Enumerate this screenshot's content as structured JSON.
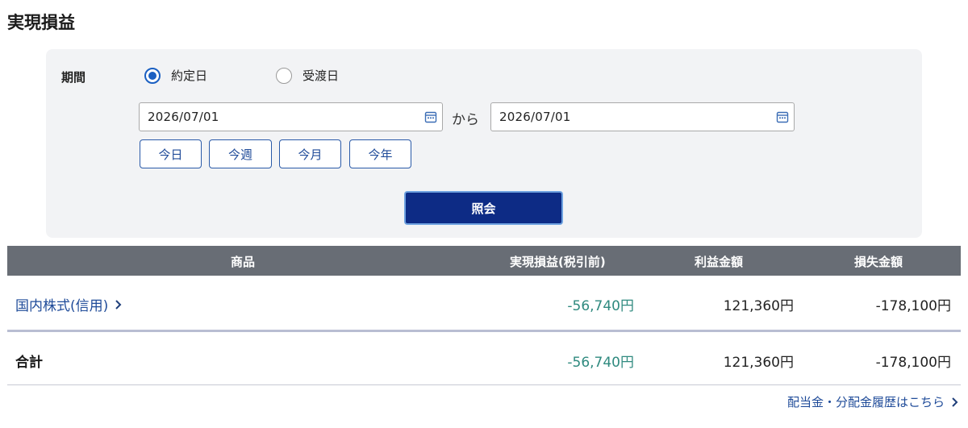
{
  "page": {
    "title": "実現損益"
  },
  "filter": {
    "period_label": "期間",
    "radios": [
      {
        "label": "約定日",
        "checked": true
      },
      {
        "label": "受渡日",
        "checked": false
      }
    ],
    "date_from": "2026/07/01",
    "separator": "から",
    "date_to": "2026/07/01",
    "quick_buttons": [
      "今日",
      "今週",
      "今月",
      "今年"
    ],
    "submit_label": "照会"
  },
  "table": {
    "headers": {
      "product": "商品",
      "realized": "実現損益(税引前)",
      "profit": "利益金額",
      "loss": "損失金額"
    },
    "rows": [
      {
        "product": "国内株式(信用)",
        "realized": "-56,740円",
        "profit": "121,360円",
        "loss": "-178,100円"
      }
    ],
    "total": {
      "label": "合計",
      "realized": "-56,740円",
      "profit": "121,360円",
      "loss": "-178,100円"
    }
  },
  "footer": {
    "dividend_link": "配当金・分配金履歴はこちら"
  },
  "colors": {
    "accent": "#1a5fc2",
    "submit_bg": "#0d2b85",
    "header_bg": "#686d75",
    "realized_text": "#2f8a7f"
  },
  "icons": [
    "calendar-icon",
    "chevron-right-icon"
  ]
}
